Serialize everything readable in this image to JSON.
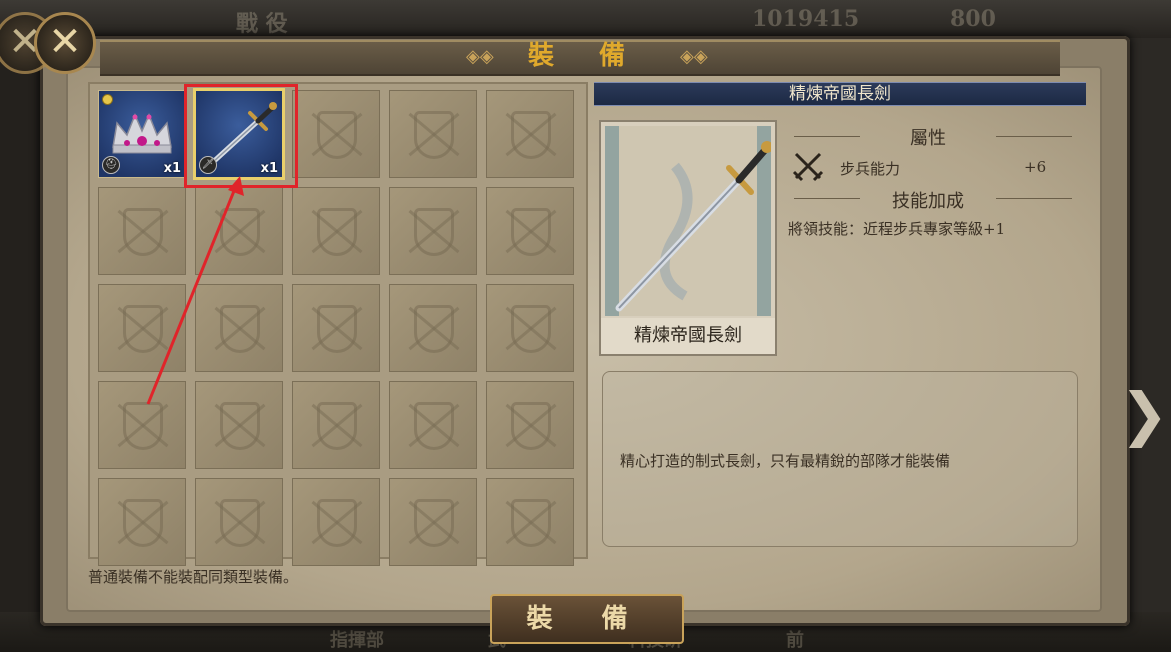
{
  "background": {
    "top_tab": "戰 役",
    "gold": "1019415",
    "food": "800",
    "bottom_tabs": [
      "指揮部",
      "武",
      "科技研",
      "前"
    ]
  },
  "window": {
    "title": "裝 備",
    "close_label": "✕"
  },
  "inventory": {
    "items": [
      {
        "name": "crown",
        "qty": "x1",
        "badge": "helmet",
        "has_dot": true,
        "selected": false
      },
      {
        "name": "sword",
        "qty": "x1",
        "badge": "sword",
        "has_dot": false,
        "selected": true
      }
    ],
    "rows": 5,
    "cols": 5
  },
  "detail": {
    "header": "精煉帝國長劍",
    "card_name": "精煉帝國長劍",
    "attr_title": "屬性",
    "attr_label": "步兵能力",
    "attr_value": "+6",
    "skill_title": "技能加成",
    "skill_text": "將領技能：近程步兵專家等級+1",
    "description": "精心打造的制式長劍，只有最精銳的部隊才能裝備"
  },
  "footer_note": "普通裝備不能裝配同類型裝備。",
  "equip_button": "裝 備",
  "colors": {
    "title_gold": "#e0a92c",
    "highlight_red": "#e0242a",
    "slot_blue": "#2a4680"
  }
}
